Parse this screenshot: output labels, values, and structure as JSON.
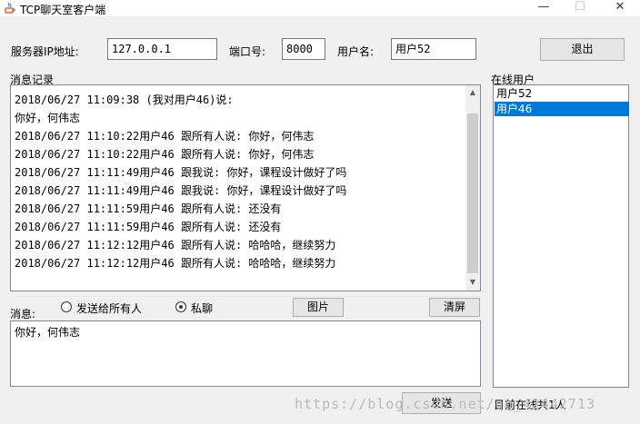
{
  "window": {
    "title": "TCP聊天室客户端",
    "minimize": "—",
    "maximize": "☐",
    "close": "✕"
  },
  "server": {
    "ip_label": "服务器IP地址:",
    "ip_value": "127.0.0.1",
    "port_label": "端口号:",
    "port_value": "8000",
    "user_label": "用户名:",
    "user_value": "用户52",
    "exit_label": "退出"
  },
  "messages": {
    "label": "消息记录",
    "lines": [
      "2018/06/27 11:09:38 (我对用户46)说:",
      "你好，何伟志",
      "2018/06/27 11:10:22用户46 跟所有人说: 你好，何伟志",
      "2018/06/27 11:10:22用户46 跟所有人说: 你好，何伟志",
      "2018/06/27 11:11:49用户46 跟我说: 你好，课程设计做好了吗",
      "2018/06/27 11:11:49用户46 跟我说: 你好，课程设计做好了吗",
      "2018/06/27 11:11:59用户46 跟所有人说: 还没有",
      "2018/06/27 11:11:59用户46 跟所有人说: 还没有",
      "2018/06/27 11:12:12用户46 跟所有人说: 哈哈哈，继续努力",
      "2018/06/27 11:12:12用户46 跟所有人说: 哈哈哈，继续努力"
    ]
  },
  "online": {
    "label": "在线用户",
    "users": [
      "用户52",
      "用户46"
    ],
    "selected_index": 1,
    "count_text": "目前在线共1人"
  },
  "compose": {
    "label": "消息:",
    "radio_all": "发送给所有人",
    "radio_private": "私聊",
    "radio_private_checked": true,
    "image_button": "图片",
    "clear_button": "清屏",
    "input_value": "你好，何伟志",
    "send_button": "发送"
  },
  "watermark": "https://blog.csdn.net/qq_42442713"
}
